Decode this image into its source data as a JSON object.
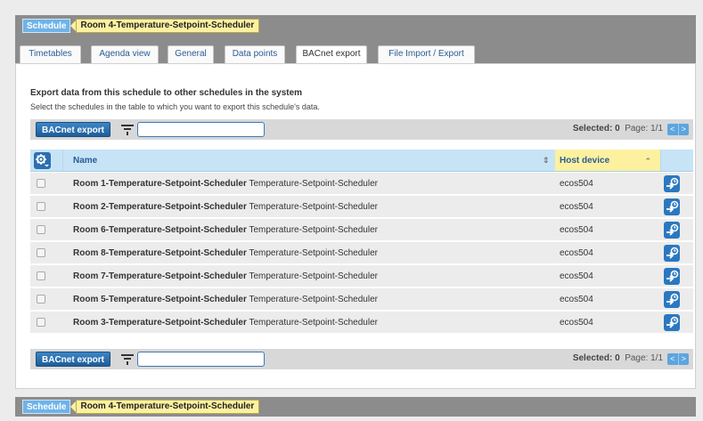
{
  "breadcrumb": {
    "schedule": "Schedule",
    "object": "Room 4-Temperature-Setpoint-Scheduler"
  },
  "tabs": [
    {
      "label": "Timetables",
      "active": false
    },
    {
      "label": "Agenda view",
      "active": false
    },
    {
      "label": "General",
      "active": false
    },
    {
      "label": "Data points",
      "active": false
    },
    {
      "label": "BACnet export",
      "active": true
    },
    {
      "label": "File Import / Export",
      "active": false
    }
  ],
  "section": {
    "heading": "Export data from this schedule to other schedules in the system",
    "subheading": "Select the schedules in the table to which you want to export this schedule's data."
  },
  "toolbar": {
    "export_label": "BACnet export",
    "filter_value": "",
    "selected_label": "Selected:",
    "selected_count": "0",
    "page_label": "Page: 1/1",
    "prev": "<",
    "next": ">"
  },
  "table": {
    "columns": {
      "name": "Name",
      "host": "Host device"
    },
    "rows": [
      {
        "object_name": "Room 1-Temperature-Setpoint-Scheduler",
        "type": "Temperature-Setpoint-Scheduler",
        "host": "ecos504"
      },
      {
        "object_name": "Room 2-Temperature-Setpoint-Scheduler",
        "type": "Temperature-Setpoint-Scheduler",
        "host": "ecos504"
      },
      {
        "object_name": "Room 6-Temperature-Setpoint-Scheduler",
        "type": "Temperature-Setpoint-Scheduler",
        "host": "ecos504"
      },
      {
        "object_name": "Room 8-Temperature-Setpoint-Scheduler",
        "type": "Temperature-Setpoint-Scheduler",
        "host": "ecos504"
      },
      {
        "object_name": "Room 7-Temperature-Setpoint-Scheduler",
        "type": "Temperature-Setpoint-Scheduler",
        "host": "ecos504"
      },
      {
        "object_name": "Room 5-Temperature-Setpoint-Scheduler",
        "type": "Temperature-Setpoint-Scheduler",
        "host": "ecos504"
      },
      {
        "object_name": "Room 3-Temperature-Setpoint-Scheduler",
        "type": "Temperature-Setpoint-Scheduler",
        "host": "ecos504"
      }
    ]
  },
  "colors": {
    "accent": "#2a78c0",
    "header_bg": "#c6e4f6",
    "highlight": "#fdf1a0",
    "frame": "#8c8c8c"
  },
  "icons": [
    "filter-icon",
    "gear-icon",
    "export-arrow-icon",
    "sort-icon"
  ]
}
